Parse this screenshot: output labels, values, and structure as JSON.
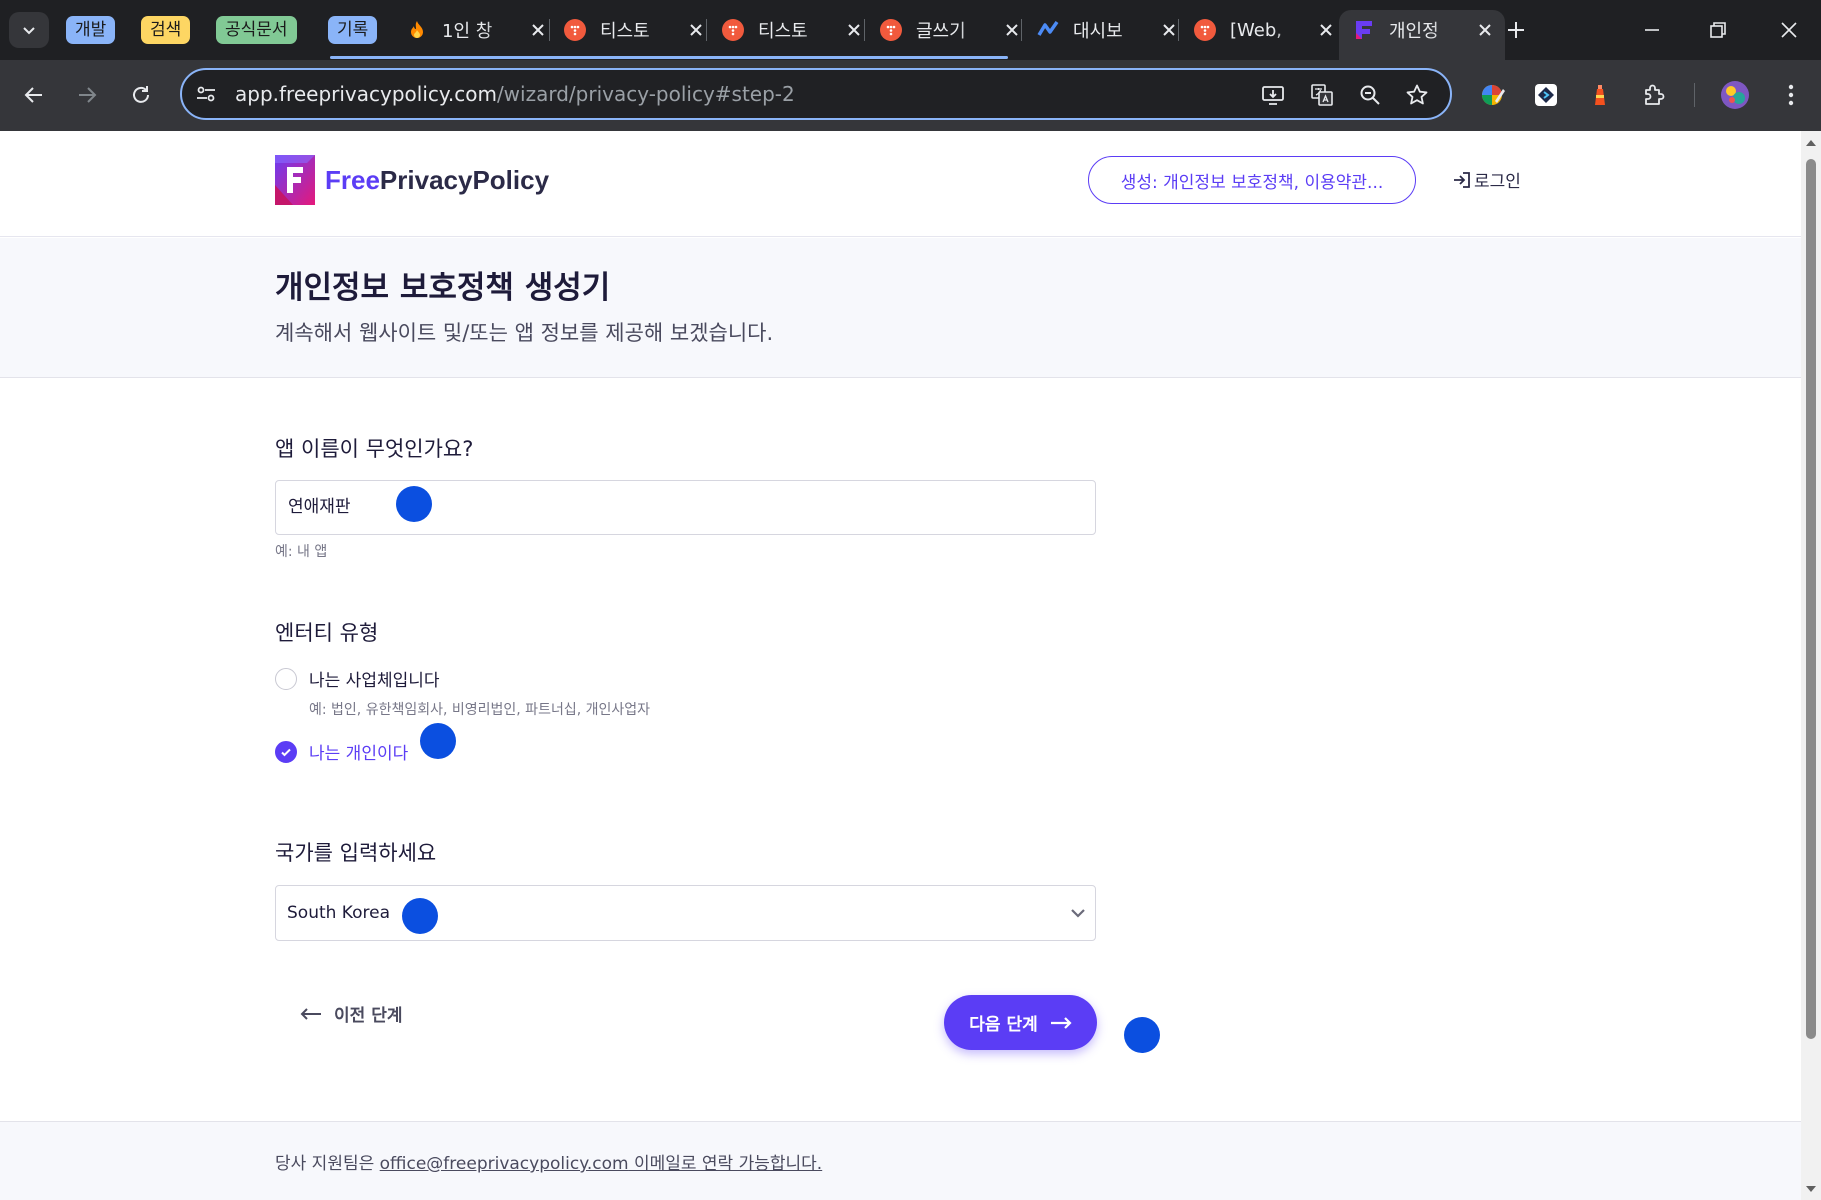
{
  "browser": {
    "tab_groups": [
      {
        "label": "개발",
        "color": "#8ab4f8"
      },
      {
        "label": "검색",
        "color": "#fdd663"
      },
      {
        "label": "공식문서",
        "color": "#81c995"
      },
      {
        "label": "기록",
        "color": "#8ab4f8"
      }
    ],
    "tabs": [
      {
        "title": "1인 창",
        "favicon": "fire-icon"
      },
      {
        "title": "티스토",
        "favicon": "tistory-icon"
      },
      {
        "title": "티스토",
        "favicon": "tistory-icon"
      },
      {
        "title": "글쓰기",
        "favicon": "tistory-icon"
      },
      {
        "title": "대시보",
        "favicon": "dashboard-icon"
      },
      {
        "title": "[Web,",
        "favicon": "tistory-icon"
      },
      {
        "title": "개인정",
        "favicon": "freeprivacypolicy-icon",
        "active": true
      }
    ],
    "url_host": "app.freeprivacypolicy.com",
    "url_path": "/wizard/privacy-policy#step-2"
  },
  "site": {
    "logo_free": "Free",
    "logo_rest": "PrivacyPolicy",
    "generate_button": "생성: 개인정보 보호정책, 이용약관...",
    "login": "로그인"
  },
  "hero": {
    "title": "개인정보 보호정책 생성기",
    "subtitle": "계속해서 웹사이트 및/또는 앱 정보를 제공해 보겠습니다."
  },
  "form": {
    "app_name_label": "앱 이름이 무엇인가요?",
    "app_name_value": "연애재판",
    "app_name_hint": "예: 내 앱",
    "entity_label": "엔터티 유형",
    "entity_business": "나는 사업체입니다",
    "entity_business_hint": "예: 법인, 유한책임회사, 비영리법인, 파트너십, 개인사업자",
    "entity_individual": "나는 개인이다",
    "entity_selected": "individual",
    "country_label": "국가를 입력하세요",
    "country_value": "South Korea",
    "prev_button": "이전 단계",
    "next_button": "다음 단계"
  },
  "footer": {
    "text_before": "당사 지원팀은 ",
    "email": "office@freeprivacypolicy.com",
    "text_after": " 이메일로 연락 가능합니다."
  },
  "colors": {
    "brand": "#5b3df5",
    "marker": "#0b4fe0"
  }
}
